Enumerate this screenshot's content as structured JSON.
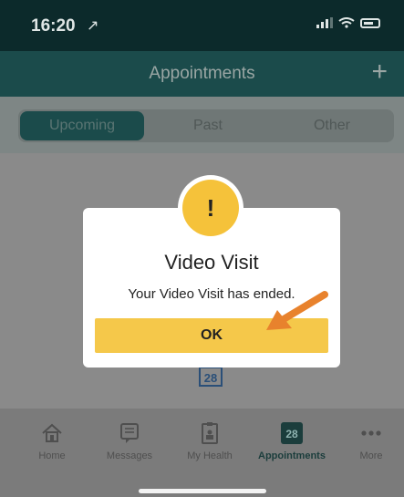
{
  "status": {
    "time": "16:20",
    "location_glyph": "↗"
  },
  "nav": {
    "title": "Appointments",
    "add_glyph": "+"
  },
  "tabs": [
    {
      "label": "Upcoming",
      "active": true
    },
    {
      "label": "Past",
      "active": false
    },
    {
      "label": "Other",
      "active": false
    }
  ],
  "content": {
    "calendar_day": "28"
  },
  "dialog": {
    "alert_glyph": "!",
    "title": "Video Visit",
    "message": "Your Video Visit has ended.",
    "ok_label": "OK"
  },
  "tabbar": {
    "items": [
      {
        "label": "Home",
        "icon": "home-icon"
      },
      {
        "label": "Messages",
        "icon": "message-icon"
      },
      {
        "label": "My Health",
        "icon": "health-record-icon"
      },
      {
        "label": "Appointments",
        "icon": "calendar-icon",
        "badge": "28",
        "active": true
      },
      {
        "label": "More",
        "icon": "more-icon"
      }
    ]
  },
  "colors": {
    "header": "#1b4b4b",
    "accent": "#f5c23a",
    "arrow": "#e8822d"
  }
}
